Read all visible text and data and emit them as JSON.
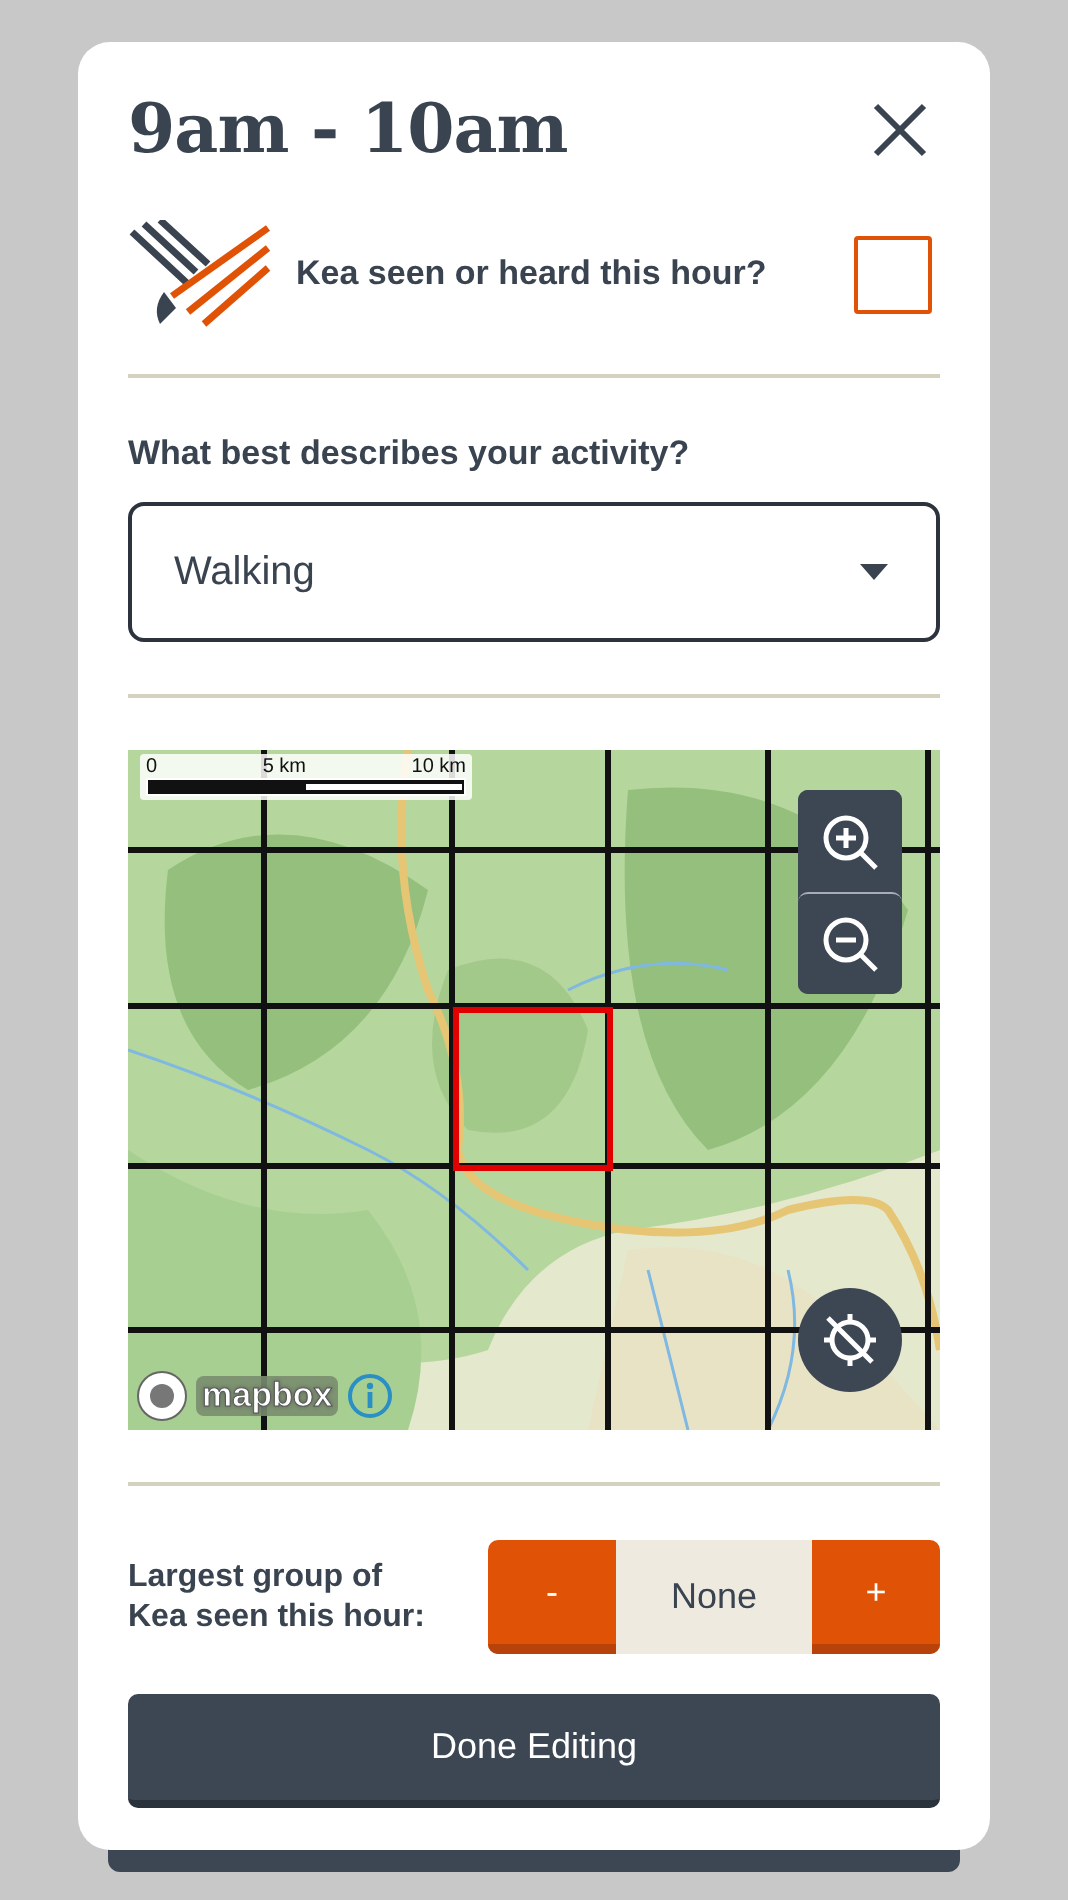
{
  "header": {
    "title": "9am - 10am"
  },
  "kea_seen": {
    "label": "Kea seen or heard this hour?",
    "checked": false
  },
  "activity": {
    "question": "What best describes your activity?",
    "value": "Walking"
  },
  "map": {
    "scale_labels": [
      "0",
      "5 km",
      "10 km"
    ],
    "attribution": "mapbox"
  },
  "group_size": {
    "label": "Largest group of Kea seen this hour:",
    "decrement": "-",
    "value": "None",
    "increment": "+"
  },
  "done_button": "Done Editing"
}
